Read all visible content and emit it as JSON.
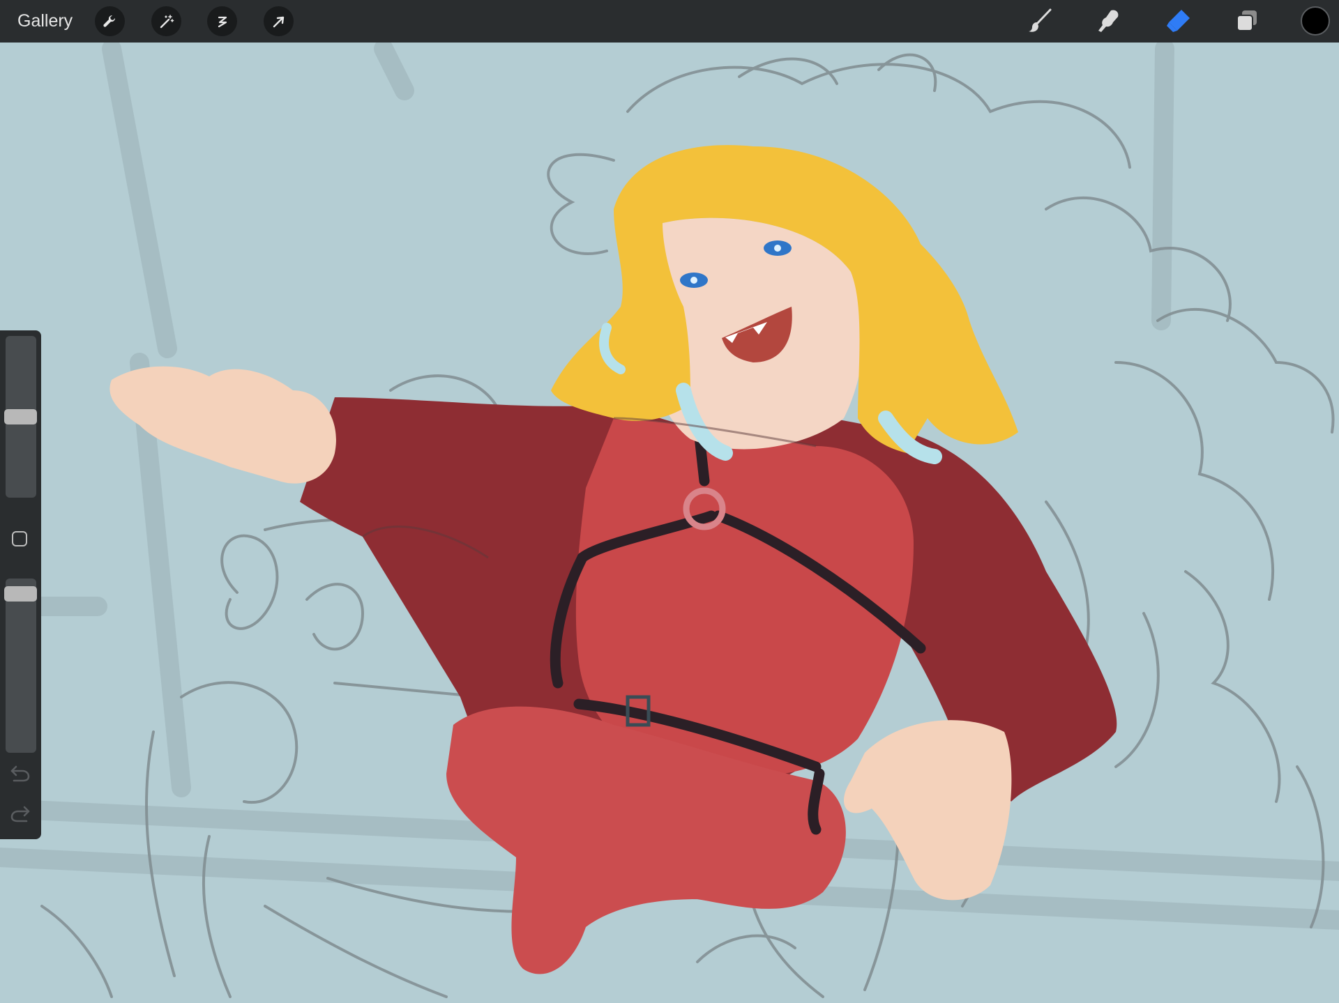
{
  "topbar": {
    "gallery_label": "Gallery",
    "left_tools": [
      "actions-icon",
      "adjustments-icon",
      "selection-icon",
      "transform-icon"
    ],
    "right_tools": [
      "brush-icon",
      "smudge-icon",
      "eraser-icon",
      "layers-icon"
    ],
    "active_tool": "eraser-icon",
    "active_color": "#000000",
    "active_tool_color": "#2f7cf6"
  },
  "sidebar": {
    "brush_size": 0.5,
    "opacity": 0.95,
    "icons": [
      "modify-button-icon",
      "undo-icon",
      "redo-icon"
    ]
  },
  "canvas": {
    "background_color": "#b4cdd3"
  }
}
